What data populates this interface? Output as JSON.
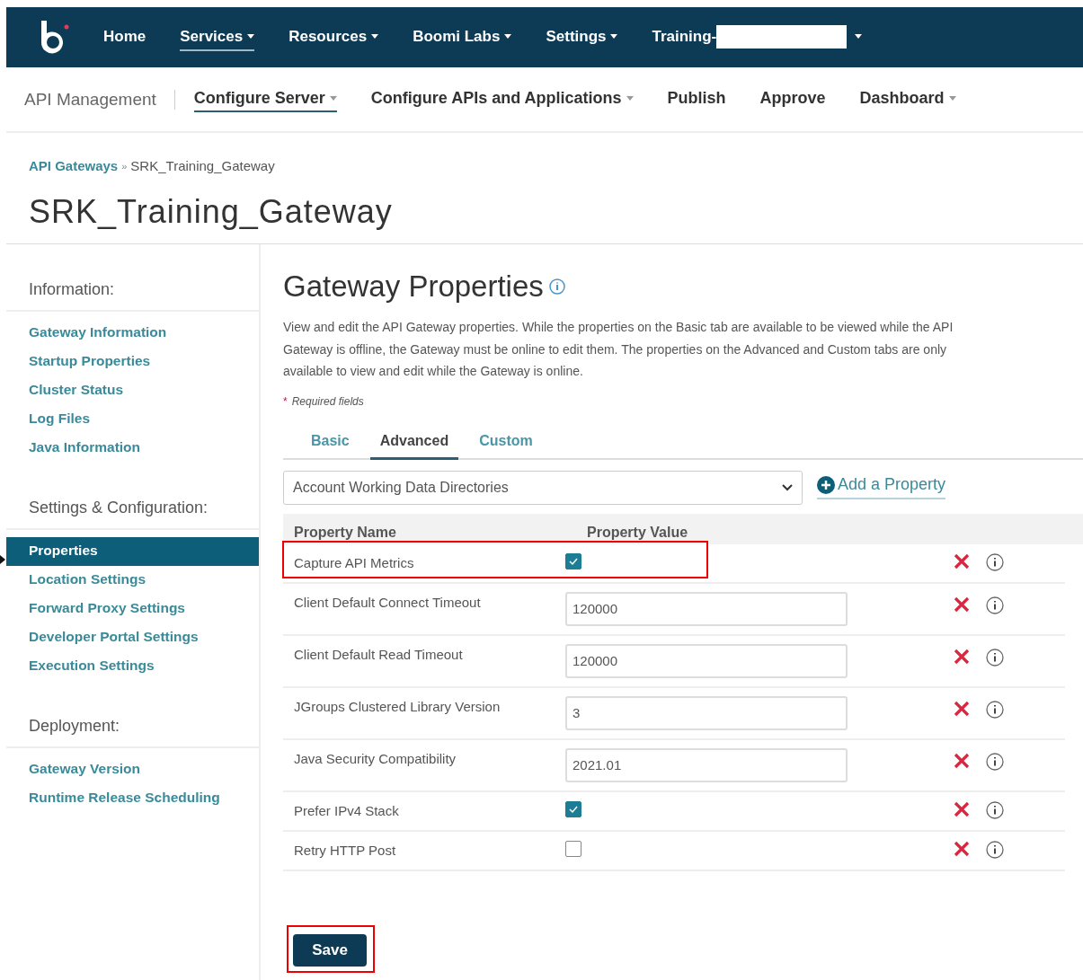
{
  "top_nav": {
    "items": [
      {
        "label": "Home",
        "dropdown": false,
        "selected": false
      },
      {
        "label": "Services",
        "dropdown": true,
        "selected": true
      },
      {
        "label": "Resources",
        "dropdown": true,
        "selected": false
      },
      {
        "label": "Boomi Labs",
        "dropdown": true,
        "selected": false
      },
      {
        "label": "Settings",
        "dropdown": true,
        "selected": false
      },
      {
        "label": "Training-",
        "dropdown": true,
        "selected": false,
        "redacted": true
      }
    ]
  },
  "sub_nav": {
    "title": "API Management",
    "items": [
      {
        "label": "Configure Server",
        "dropdown": true,
        "selected": true
      },
      {
        "label": "Configure APIs and Applications",
        "dropdown": true,
        "selected": false
      },
      {
        "label": "Publish",
        "dropdown": false,
        "selected": false
      },
      {
        "label": "Approve",
        "dropdown": false,
        "selected": false
      },
      {
        "label": "Dashboard",
        "dropdown": true,
        "selected": false
      }
    ]
  },
  "breadcrumb": [
    {
      "label": "API Gateways",
      "link": true
    },
    {
      "label": "SRK_Training_Gateway",
      "link": false
    }
  ],
  "breadcrumb_separator": "»",
  "page_title": "SRK_Training_Gateway",
  "sidebar": {
    "sections": [
      {
        "heading": "Information:",
        "items": [
          {
            "label": "Gateway Information",
            "selected": false
          },
          {
            "label": "Startup Properties",
            "selected": false
          },
          {
            "label": "Cluster Status",
            "selected": false
          },
          {
            "label": "Log Files",
            "selected": false
          },
          {
            "label": "Java Information",
            "selected": false
          }
        ]
      },
      {
        "heading": "Settings & Configuration:",
        "items": [
          {
            "label": "Properties",
            "selected": true
          },
          {
            "label": "Location Settings",
            "selected": false
          },
          {
            "label": "Forward Proxy Settings",
            "selected": false
          },
          {
            "label": "Developer Portal Settings",
            "selected": false
          },
          {
            "label": "Execution Settings",
            "selected": false
          }
        ]
      },
      {
        "heading": "Deployment:",
        "items": [
          {
            "label": "Gateway Version",
            "selected": false
          },
          {
            "label": "Runtime Release Scheduling",
            "selected": false
          }
        ]
      }
    ]
  },
  "content": {
    "title": "Gateway Properties",
    "description": "View and edit the API Gateway properties. While the properties on the Basic tab are available to be viewed while the API Gateway is offline, the Gateway must be online to edit them. The properties on the Advanced and Custom tabs are only available to view and edit while the Gateway is online.",
    "required_mark": "*",
    "required_note": "Required fields",
    "tabs": [
      {
        "label": "Basic",
        "selected": false
      },
      {
        "label": "Advanced",
        "selected": true
      },
      {
        "label": "Custom",
        "selected": false
      }
    ],
    "property_select": {
      "value": "Account Working Data Directories"
    },
    "add_property": "Add a Property",
    "columns": [
      "Property Name",
      "Property Value"
    ],
    "rows": [
      {
        "name": "Capture API Metrics",
        "kind": "checkbox",
        "checked": true,
        "highlighted": true
      },
      {
        "name": "Client Default Connect Timeout",
        "kind": "text",
        "value": "120000"
      },
      {
        "name": "Client Default Read Timeout",
        "kind": "text",
        "value": "120000"
      },
      {
        "name": "JGroups Clustered Library Version",
        "kind": "text",
        "value": "3"
      },
      {
        "name": "Java Security Compatibility",
        "kind": "text",
        "value": "2021.01"
      },
      {
        "name": "Prefer IPv4 Stack",
        "kind": "checkbox",
        "checked": true
      },
      {
        "name": "Retry HTTP Post",
        "kind": "checkbox",
        "checked": false
      }
    ],
    "save_button": {
      "label": "Save",
      "highlighted": true
    }
  }
}
